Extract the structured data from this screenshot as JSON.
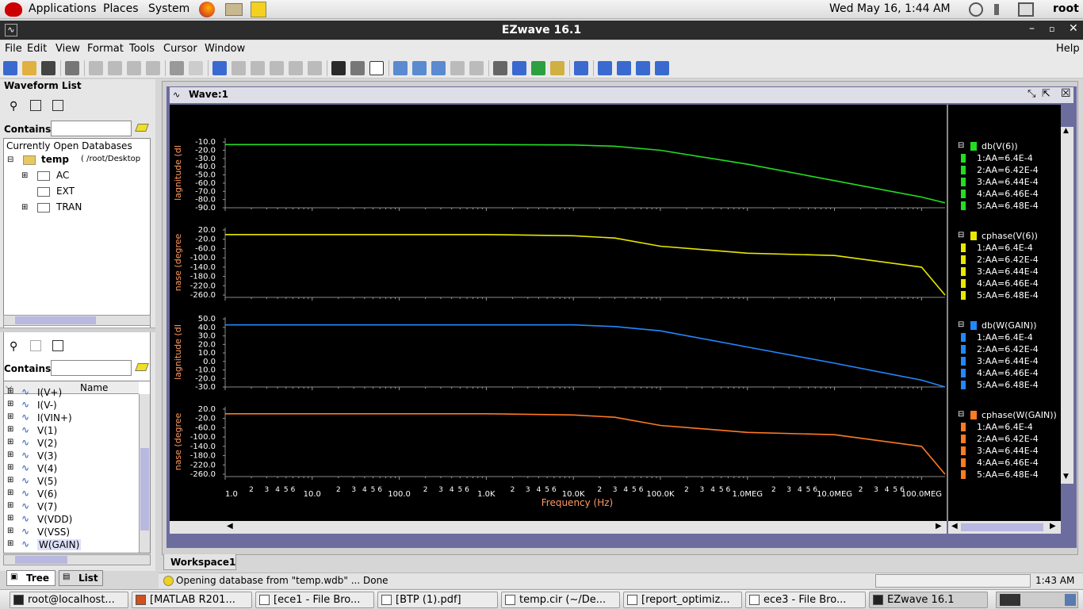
{
  "topbar": {
    "applications": "Applications",
    "places": "Places",
    "system": "System",
    "datetime": "Wed May 16,  1:44 AM",
    "user": "root"
  },
  "window": {
    "title": "EZwave 16.1"
  },
  "menu": {
    "file": "File",
    "edit": "Edit",
    "view": "View",
    "format": "Format",
    "tools": "Tools",
    "cursor": "Cursor",
    "window": "Window",
    "help": "Help"
  },
  "waveform_list": {
    "title": "Waveform List",
    "contains_label": "Contains",
    "db_header": "Currently Open Databases",
    "db_name": "temp",
    "db_path": "( /root/Desktop",
    "folders": [
      "AC",
      "EXT",
      "TRAN"
    ],
    "contains_label2": "Contains",
    "name_header": "Name",
    "signals": [
      "I(V+)",
      "I(V-)",
      "I(VIN+)",
      "V(1)",
      "V(2)",
      "V(3)",
      "V(4)",
      "V(5)",
      "V(6)",
      "V(7)",
      "V(VDD)",
      "V(VSS)",
      "W(GAIN)"
    ],
    "tab_tree": "Tree",
    "tab_list": "List"
  },
  "wave": {
    "window_title": "Wave:1",
    "workspace_tab": "Workspace1"
  },
  "chart_data": {
    "type": "line",
    "xlabel": "Frequency (Hz)",
    "x_scale": "log",
    "x_ticks": [
      "1.0",
      "10.0",
      "100.0",
      "1.0K",
      "10.0K",
      "100.0K",
      "1.0MEG",
      "10.0MEG",
      "100.0MEG"
    ],
    "x": [
      1,
      10,
      100,
      1000,
      10000,
      30000,
      100000,
      1000000,
      10000000,
      100000000,
      200000000
    ],
    "panels": [
      {
        "name": "db(V(6))",
        "ylabel": "lagnitude (dI",
        "color": "#22dd22",
        "yticks": [
          "-10.0",
          "-20.0",
          "-30.0",
          "-40.0",
          "-50.0",
          "-60.0",
          "-70.0",
          "-80.0",
          "-90.0"
        ],
        "ylim": [
          -90,
          -5
        ],
        "values": [
          -13,
          -13,
          -13,
          -13,
          -13.5,
          -15,
          -20,
          -37,
          -57,
          -77,
          -84
        ]
      },
      {
        "name": "cphase(V(6))",
        "ylabel": "nase (degree",
        "color": "#e8e800",
        "yticks": [
          "20.0",
          "-20.0",
          "-60.0",
          "-100.0",
          "-140.0",
          "-180.0",
          "-220.0",
          "-260.0"
        ],
        "ylim": [
          -270,
          30
        ],
        "values": [
          0,
          0,
          0,
          0,
          -5,
          -15,
          -50,
          -80,
          -90,
          -140,
          -260
        ]
      },
      {
        "name": "db(W(GAIN))",
        "ylabel": "lagnitude (dI",
        "color": "#2288ff",
        "yticks": [
          "50.0",
          "40.0",
          "30.0",
          "20.0",
          "10.0",
          "0.0",
          "-10.0",
          "-20.0",
          "-30.0"
        ],
        "ylim": [
          -30,
          52
        ],
        "values": [
          43,
          43,
          43,
          43,
          43,
          41,
          36,
          17,
          -2,
          -22,
          -30
        ]
      },
      {
        "name": "cphase(W(GAIN))",
        "ylabel": "nase (degree",
        "color": "#ff7a22",
        "yticks": [
          "20.0",
          "-20.0",
          "-60.0",
          "-100.0",
          "-140.0",
          "-180.0",
          "-220.0",
          "-260.0"
        ],
        "ylim": [
          -270,
          30
        ],
        "values": [
          0,
          0,
          0,
          0,
          -5,
          -15,
          -50,
          -80,
          -90,
          -140,
          -260
        ]
      }
    ],
    "legend_entries": [
      "1:AA=6.4E-4",
      "2:AA=6.42E-4",
      "3:AA=6.44E-4",
      "4:AA=6.46E-4",
      "5:AA=6.48E-4"
    ]
  },
  "status": {
    "message": "Opening database from \"temp.wdb\" ... Done",
    "time": "1:43 AM"
  },
  "taskbar": [
    "root@localhost...",
    "[MATLAB R201...",
    "[ece1 - File Bro...",
    "[BTP (1).pdf]",
    "temp.cir (~/De...",
    "[report_optimiz...",
    "ece3 - File Bro...",
    "EZwave 16.1"
  ],
  "colors": {
    "accent": "#3a3a8e",
    "plot_bg": "#000000",
    "axis_label": "#ff9a60"
  }
}
